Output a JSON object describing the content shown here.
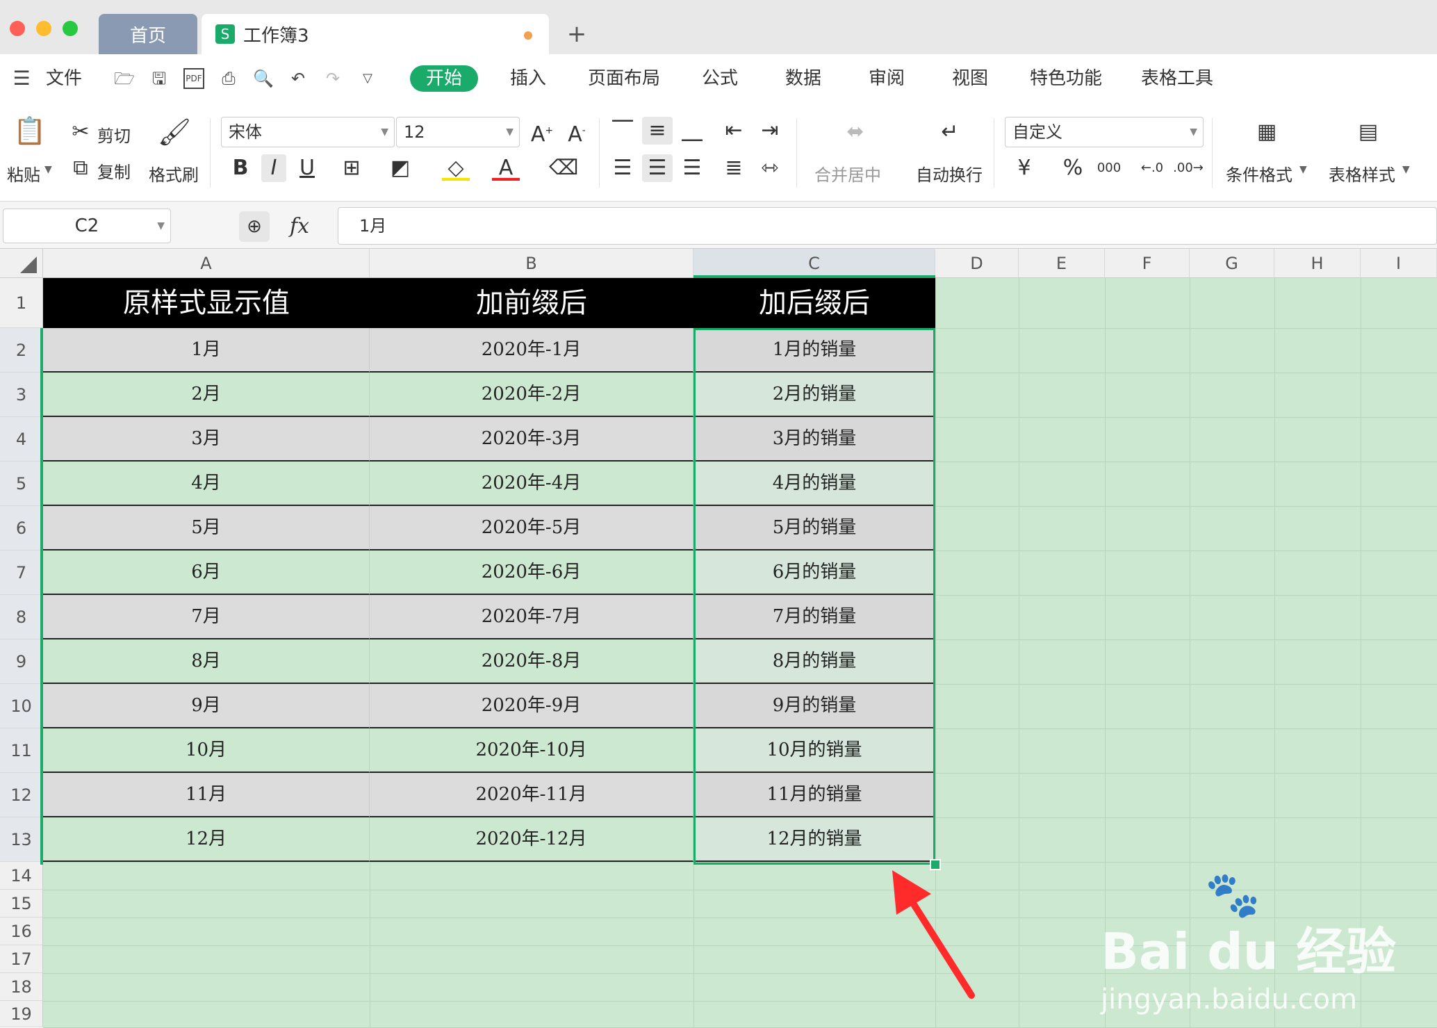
{
  "tabs": {
    "home": "首页",
    "workbook": "工作簿3",
    "add": "+"
  },
  "menu": {
    "file": "文件",
    "items": [
      "开始",
      "插入",
      "页面布局",
      "公式",
      "数据",
      "审阅",
      "视图",
      "特色功能",
      "表格工具"
    ]
  },
  "ribbon": {
    "paste": "粘贴",
    "cut": "剪切",
    "copy": "复制",
    "format_painter": "格式刷",
    "font_name": "宋体",
    "font_size": "12",
    "merge_center": "合并居中",
    "wrap_text": "自动换行",
    "number_format": "自定义",
    "cond_format": "条件格式",
    "table_style": "表格样式",
    "currency": "¥",
    "percent": "%",
    "thousands": "000"
  },
  "formula_bar": {
    "name_box": "C2",
    "fx": "fx",
    "content": "1月"
  },
  "columns": [
    "A",
    "B",
    "C",
    "D",
    "E",
    "F",
    "G",
    "H",
    "I"
  ],
  "rows": [
    "1",
    "2",
    "3",
    "4",
    "5",
    "6",
    "7",
    "8",
    "9",
    "10",
    "11",
    "12",
    "13",
    "14",
    "15",
    "16",
    "17",
    "18",
    "19"
  ],
  "table": {
    "headers": [
      "原样式显示值",
      "加前缀后",
      "加后缀后"
    ],
    "data": [
      [
        "1月",
        "2020年-1月",
        "1月的销量"
      ],
      [
        "2月",
        "2020年-2月",
        "2月的销量"
      ],
      [
        "3月",
        "2020年-3月",
        "3月的销量"
      ],
      [
        "4月",
        "2020年-4月",
        "4月的销量"
      ],
      [
        "5月",
        "2020年-5月",
        "5月的销量"
      ],
      [
        "6月",
        "2020年-6月",
        "6月的销量"
      ],
      [
        "7月",
        "2020年-7月",
        "7月的销量"
      ],
      [
        "8月",
        "2020年-8月",
        "8月的销量"
      ],
      [
        "9月",
        "2020年-9月",
        "9月的销量"
      ],
      [
        "10月",
        "2020年-10月",
        "10月的销量"
      ],
      [
        "11月",
        "2020年-11月",
        "11月的销量"
      ],
      [
        "12月",
        "2020年-12月",
        "12月的销量"
      ]
    ]
  },
  "watermark": {
    "brand": "Bai du 经验",
    "url": "jingyan.baidu.com"
  },
  "colors": {
    "accent": "#1aab6b",
    "grid_bg": "#cce8d0",
    "row_gray": "#dcdcdc",
    "arrow": "#ff2a2a"
  }
}
